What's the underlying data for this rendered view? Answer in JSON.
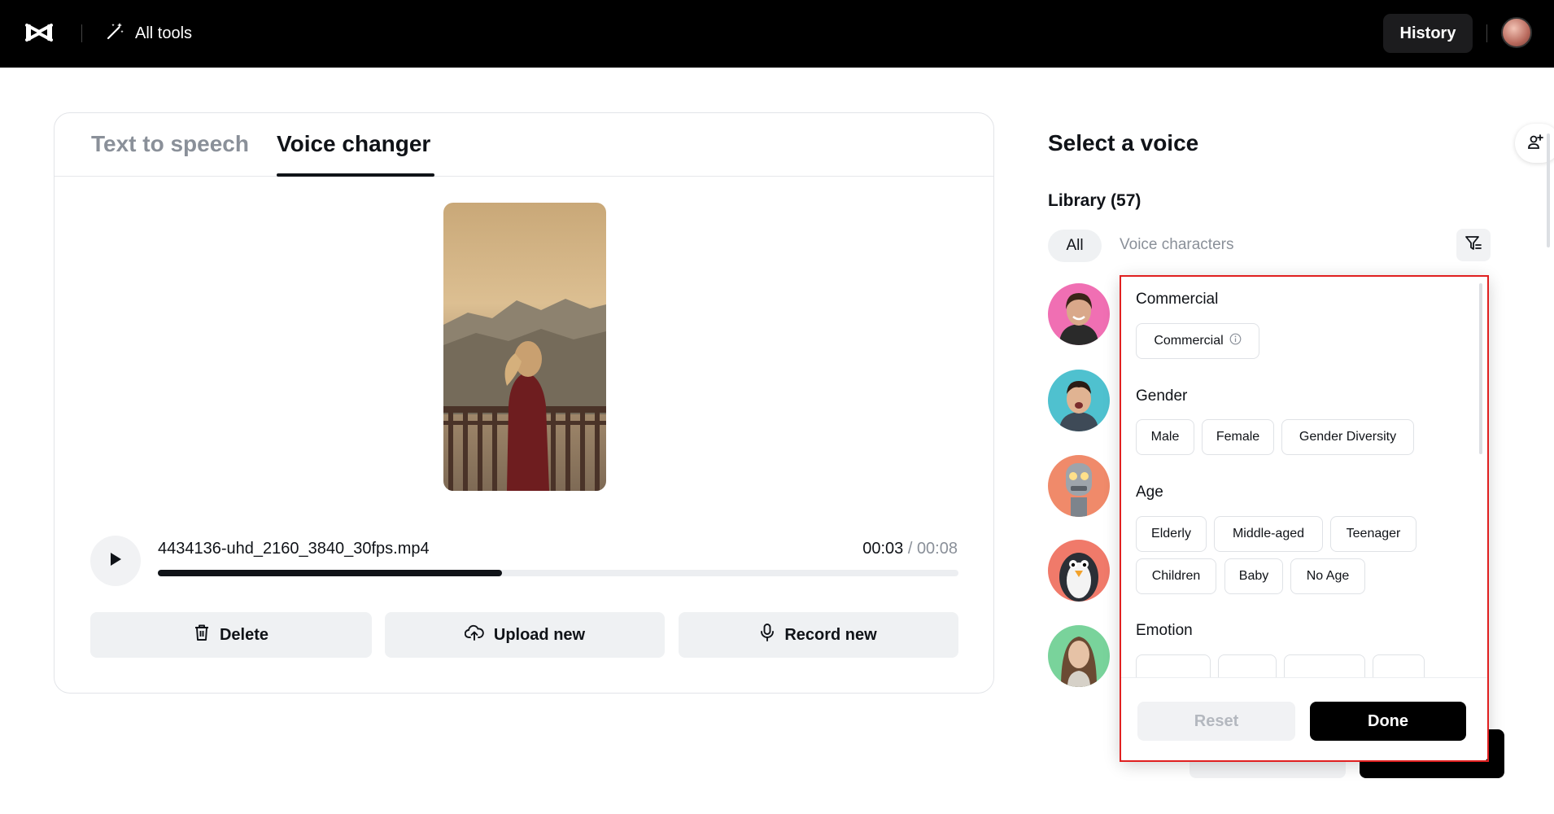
{
  "topbar": {
    "all_tools_label": "All tools",
    "history_label": "History"
  },
  "editor": {
    "tabs": [
      {
        "label": "Text to speech",
        "active": false
      },
      {
        "label": "Voice changer",
        "active": true
      }
    ],
    "media": {
      "filename": "4434136-uhd_2160_3840_30fps.mp4",
      "current_time": "00:03",
      "time_separator": " / ",
      "total_time": "00:08",
      "progress_fraction": 0.43
    },
    "actions": {
      "delete_label": "Delete",
      "upload_label": "Upload new",
      "record_label": "Record new"
    }
  },
  "voice_panel": {
    "title": "Select a voice",
    "library_label": "Library (57)",
    "filter_all_label": "All",
    "filter_characters_label": "Voice characters"
  },
  "filter_popup": {
    "commercial_title": "Commercial",
    "commercial_chip": "Commercial",
    "gender_title": "Gender",
    "gender_options": [
      "Male",
      "Female",
      "Gender Diversity"
    ],
    "age_title": "Age",
    "age_options": [
      "Elderly",
      "Middle-aged",
      "Teenager",
      "Children",
      "Baby",
      "No Age"
    ],
    "emotion_title": "Emotion",
    "reset_label": "Reset",
    "done_label": "Done"
  },
  "colors": {
    "topbar": "#000000",
    "accent": "#101318",
    "highlight": "#e02020"
  }
}
